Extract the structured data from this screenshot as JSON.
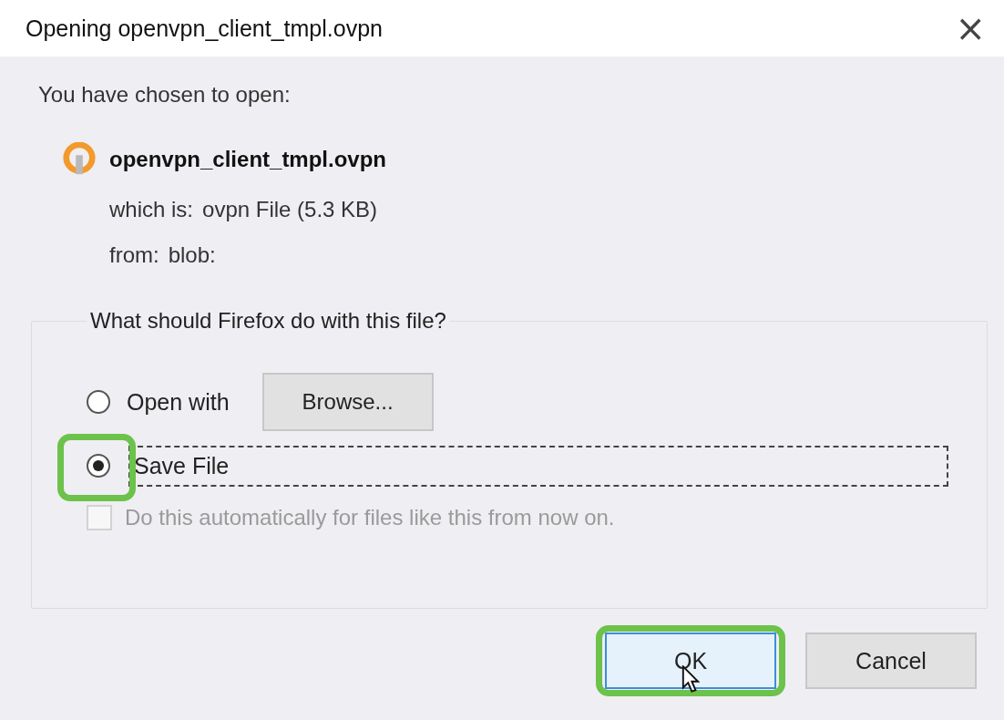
{
  "window": {
    "title": "Opening openvpn_client_tmpl.ovpn",
    "close": "×"
  },
  "intro": "You have chosen to open:",
  "file": {
    "name": "openvpn_client_tmpl.ovpn",
    "type_label": "which is:",
    "type": "ovpn File (5.3 KB)",
    "from_label": "from:",
    "from": "blob:"
  },
  "action_group": {
    "legend": "What should Firefox do with this file?",
    "options": [
      {
        "label": "Open with",
        "selected": false,
        "button": "Browse..."
      },
      {
        "label": "Save File",
        "selected": true
      }
    ],
    "auto": {
      "label": "Do this automatically for files like this from now on.",
      "checked": false,
      "disabled": true
    }
  },
  "buttons": [
    {
      "label": "OK",
      "default": true
    },
    {
      "label": "Cancel",
      "default": false
    }
  ]
}
